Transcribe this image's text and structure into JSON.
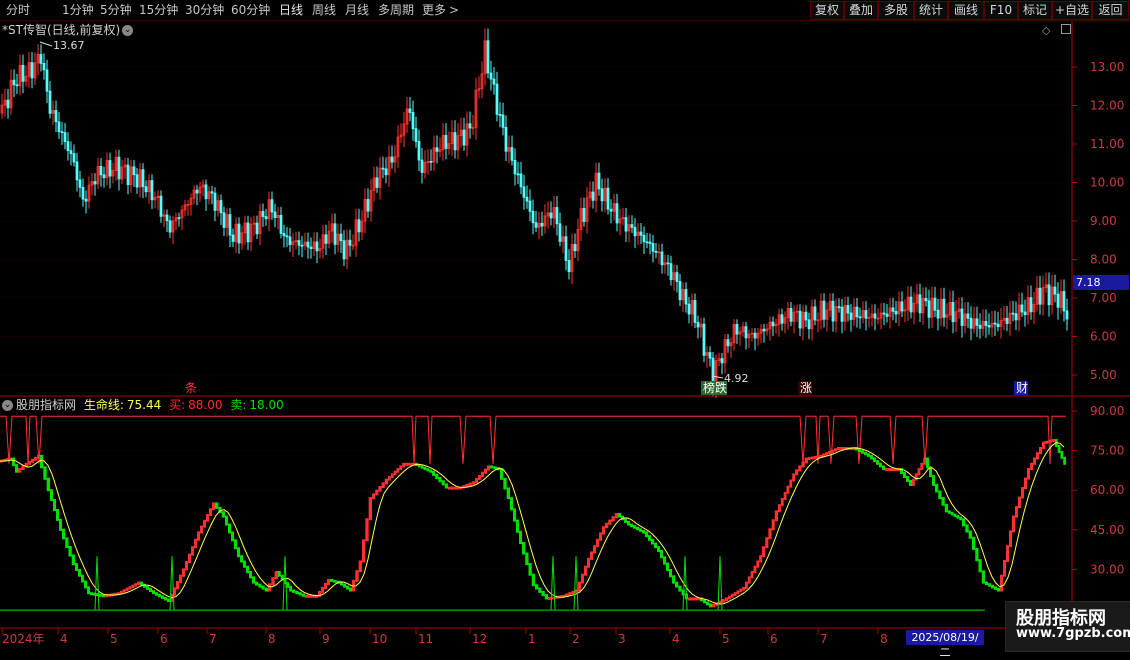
{
  "toolbar": {
    "periods": [
      "分时",
      "1分钟",
      "5分钟",
      "15分钟",
      "30分钟",
      "60分钟",
      "日线",
      "周线",
      "月线",
      "多周期",
      "更多"
    ],
    "active_period": "日线",
    "right_buttons": [
      "复权",
      "叠加",
      "多股",
      "统计",
      "画线",
      "F10",
      "标记",
      "+自选",
      "返回"
    ]
  },
  "stock": {
    "title": "*ST传智(日线,前复权)",
    "high_label": "13.67",
    "low_label": "4.92",
    "last_price": "7.18"
  },
  "indicator": {
    "name": "股朋指标网",
    "lifeline_label": "生命线:",
    "lifeline_value": "75.44",
    "buy_label": "买:",
    "buy_value": "88.00",
    "sell_label": "卖:",
    "sell_value": "18.00"
  },
  "colors": {
    "up": "#ff3030",
    "down": "#54fcfc",
    "lifeline": "#ffff55",
    "buy": "#ff3030",
    "sell": "#00e000",
    "axis": "#b00000"
  },
  "events": [
    {
      "label": "条"
    },
    {
      "label": "榜跌"
    },
    {
      "label": "涨"
    },
    {
      "label": "财"
    }
  ],
  "price_axis": [
    "13.00",
    "12.00",
    "11.00",
    "10.00",
    "9.00",
    "8.00",
    "7.00",
    "6.00",
    "5.00"
  ],
  "ind_axis": [
    "90.00",
    "75.00",
    "60.00",
    "45.00",
    "30.00"
  ],
  "date_axis": [
    "2024年",
    "4",
    "5",
    "6",
    "7",
    "8",
    "9",
    "10",
    "11",
    "12",
    "1",
    "2",
    "3",
    "4",
    "5",
    "6",
    "7",
    "8"
  ],
  "cursor_date": "2025/08/19/二",
  "watermark": {
    "title": "股朋指标网",
    "url": "www.7gpzb.com"
  }
}
